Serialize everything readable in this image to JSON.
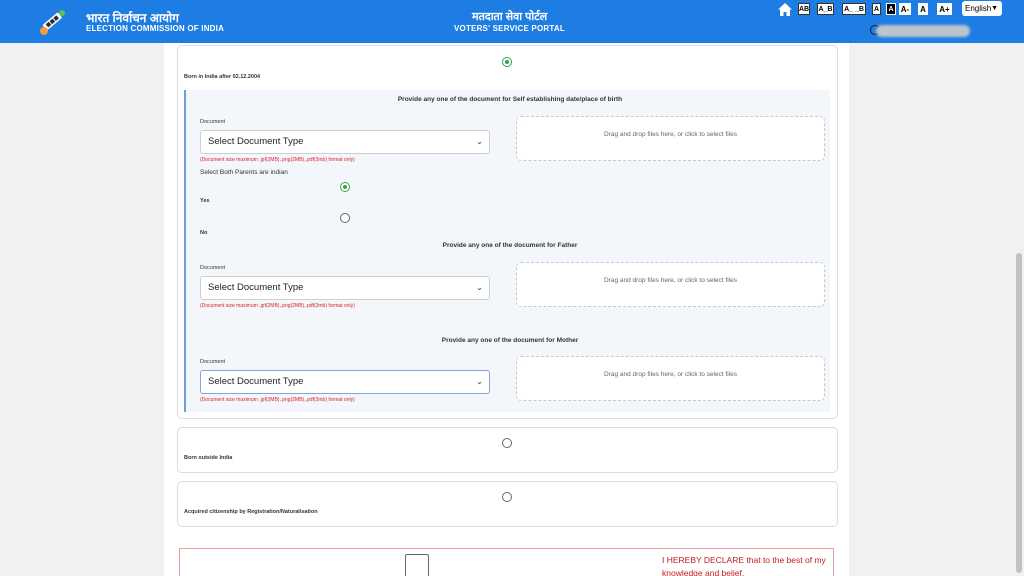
{
  "header": {
    "org_hindi": "भारत निर्वाचन आयोग",
    "org_english": "ELECTION COMMISSION OF INDIA",
    "portal_hindi": "मतदाता सेवा पोर्टल",
    "portal_english": "VOTERS' SERVICE PORTAL",
    "accessibility": [
      "AB",
      "A_B",
      "A_ _B",
      "A",
      "A",
      "A-",
      "A",
      "A+"
    ],
    "language": "English",
    "brand_color": "#1e7de3"
  },
  "options": {
    "born_in_india": "Born in India after 02.12.2004",
    "born_outside": "Born outside India",
    "acquired": "Acquired citizenship by Registration/Naturalisation"
  },
  "self_section": {
    "heading": "Provide any one of the document for Self establishing date/place of birth",
    "doc_label": "Document",
    "select_value": "Select Document Type",
    "hint": "(Document size maximum .jpf(2MB),.png(2MB),.pdf(3mb) format only)",
    "drop_text": "Drag and drop files here, or click to select files"
  },
  "parents": {
    "question": "Select Both Parents are indian",
    "yes": "Yes",
    "no": "No"
  },
  "father_section": {
    "heading": "Provide any one of the document for Father",
    "doc_label": "Document",
    "select_value": "Select Document Type",
    "hint": "(Document size maximum .jpf(2MB),.png(2MB),.pdf(3mb) format only)",
    "drop_text": "Drag and drop files here, or click to select files"
  },
  "mother_section": {
    "heading": "Provide any one of the document for Mother",
    "doc_label": "Document",
    "select_value": "Select Document Type",
    "hint": "(Document size maximum .jpf(2MB),.png(2MB),.pdf(3mb) format only)",
    "drop_text": "Drag and drop files here, or click to select files"
  },
  "declaration": {
    "text": "I HEREBY DECLARE that to the best of my knowledge and belief."
  }
}
